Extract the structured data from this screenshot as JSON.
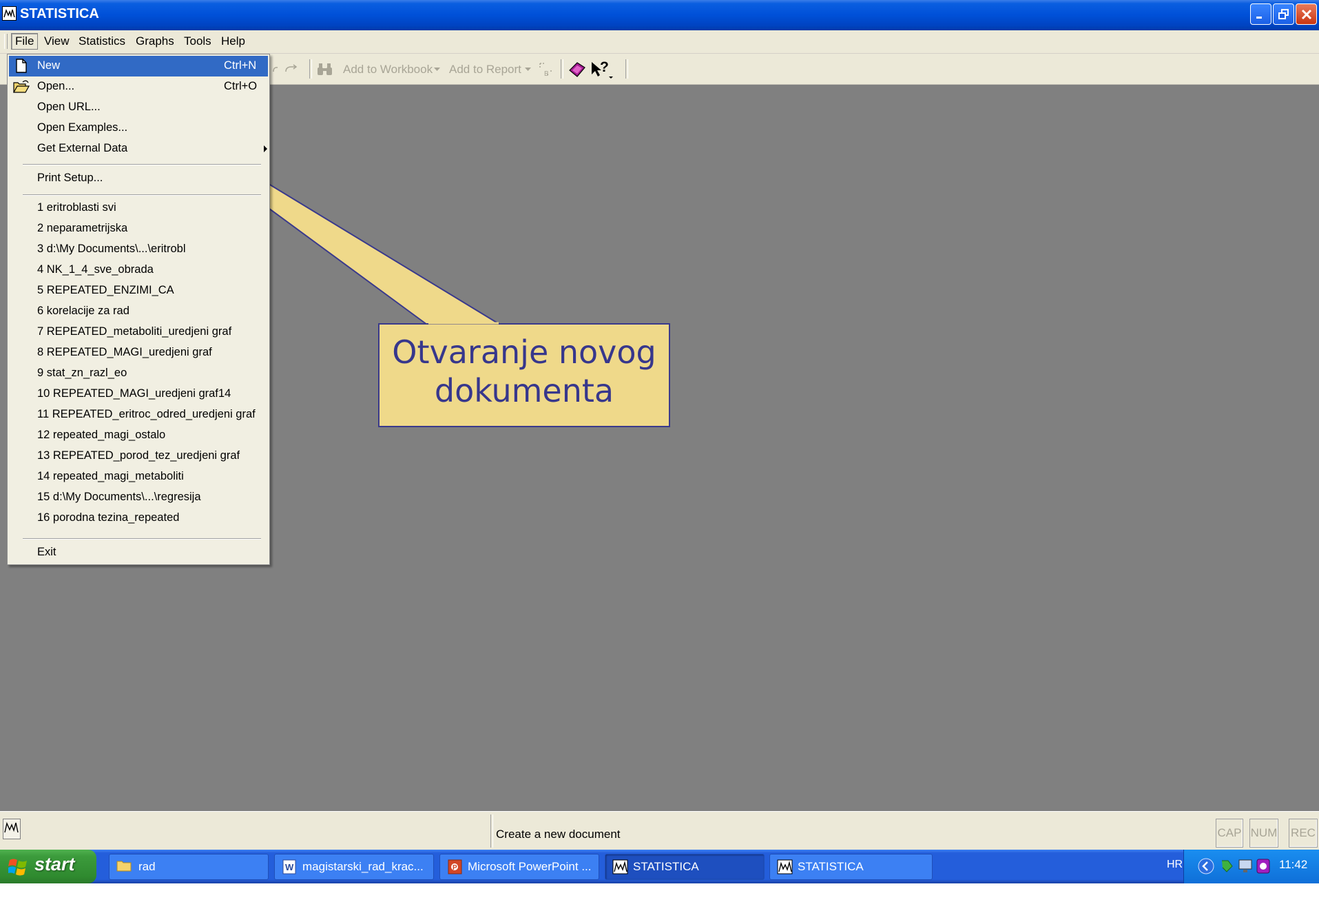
{
  "window": {
    "title": "STATISTICA"
  },
  "menubar": {
    "items": [
      "File",
      "View",
      "Statistics",
      "Graphs",
      "Tools",
      "Help"
    ]
  },
  "toolbar": {
    "add_to_workbook": "Add to Workbook",
    "add_to_report": "Add to Report"
  },
  "file_menu": {
    "new": {
      "label": "New",
      "shortcut": "Ctrl+N"
    },
    "open": {
      "label": "Open...",
      "shortcut": "Ctrl+O"
    },
    "open_url": "Open URL...",
    "open_examples": "Open Examples...",
    "get_external_data": "Get External Data",
    "print_setup": "Print Setup...",
    "recent": [
      "1 eritroblasti svi",
      "2 neparametrijska",
      "3 d:\\My Documents\\...\\eritrobl",
      "4 NK_1_4_sve_obrada",
      "5 REPEATED_ENZIMI_CA",
      "6 korelacije za rad",
      "7 REPEATED_metaboliti_uredjeni graf",
      "8 REPEATED_MAGI_uredjeni graf",
      "9 stat_zn_razl_eo",
      "10 REPEATED_MAGI_uredjeni graf14",
      "11 REPEATED_eritroc_odred_uredjeni graf",
      "12 repeated_magi_ostalo",
      "13 REPEATED_porod_tez_uredjeni graf",
      "14 repeated_magi_metaboliti",
      "15 d:\\My Documents\\...\\regresija",
      "16 porodna tezina_repeated"
    ],
    "exit": "Exit"
  },
  "callout": {
    "line1": "Otvaranje novog",
    "line2": "dokumenta"
  },
  "statusbar": {
    "text": "Create a new document",
    "cap": "CAP",
    "num": "NUM",
    "rec": "REC"
  },
  "taskbar": {
    "start": "start",
    "tasks": [
      "rad",
      "magistarski_rad_krac...",
      "Microsoft PowerPoint ...",
      "STATISTICA",
      "STATISTICA"
    ],
    "lang": "HR",
    "clock": "11:42"
  },
  "colors": {
    "menu_highlight": "#316ac5",
    "callout_fill": "#efd98a",
    "callout_text": "#37378c",
    "workspace": "#808080"
  },
  "icons": [
    "statistica-icon",
    "new-document-icon",
    "open-folder-icon",
    "binoculars-icon",
    "help-pointer-icon",
    "folder-icon",
    "word-icon",
    "powerpoint-icon"
  ]
}
